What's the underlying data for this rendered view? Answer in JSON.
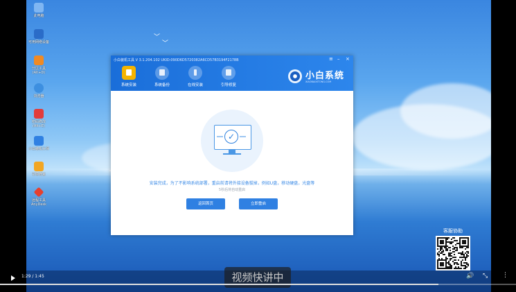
{
  "desktop": {
    "icons": [
      {
        "label": "此电脑",
        "color": "#7fb6f2",
        "icon": "computer-icon"
      },
      {
        "label": "可用网络设备",
        "color": "#2a6cc8",
        "icon": "network-icon"
      },
      {
        "label": "分区工具\n(Alt+D)",
        "color": "#f08a24",
        "icon": "partition-tool-icon"
      },
      {
        "label": "浏览器",
        "color": "#3d8fe0",
        "icon": "browser-icon"
      },
      {
        "label": "密码修改\n(Alt+E)",
        "color": "#e23b3b",
        "icon": "password-icon"
      },
      {
        "label": "小白装机大师",
        "color": "#2f80e2",
        "icon": "installer-icon"
      },
      {
        "label": "引导修复",
        "color": "#f2a623",
        "icon": "boot-repair-icon"
      },
      {
        "label": "远程工具\nAnyDesk",
        "color": "#e6402f",
        "icon": "anydesk-icon"
      }
    ]
  },
  "window": {
    "title": "小白装机工具 V 3.1.204.102 UKID:090D6D5720382A6CD57B3194F2178B",
    "controls": {
      "menu": "≡",
      "minimize": "–",
      "close": "×"
    },
    "tabs": [
      {
        "label": "系统安装",
        "active": true
      },
      {
        "label": "系统备份",
        "active": false
      },
      {
        "label": "在线安装",
        "active": false
      },
      {
        "label": "引导修复",
        "active": false
      }
    ],
    "logo": {
      "name": "小白系统",
      "url": "XIAOBAIXITONG.COM"
    },
    "message": "安装完成，为了不影响系统部署，重启前请将外接设备拔掉，例如U盘，移动硬盘，光盘等",
    "countdown": "5秒后将自动重启",
    "buttons": {
      "home": "返回首页",
      "restart": "立即重启"
    }
  },
  "qr": {
    "label": "客服协助"
  },
  "subtitle": "视频快讲中",
  "player": {
    "time": "1:29 / 1:45",
    "progress": 0.85,
    "icons": {
      "volume": "volume-icon",
      "pip": "pip-icon",
      "more": "more-icon"
    }
  }
}
